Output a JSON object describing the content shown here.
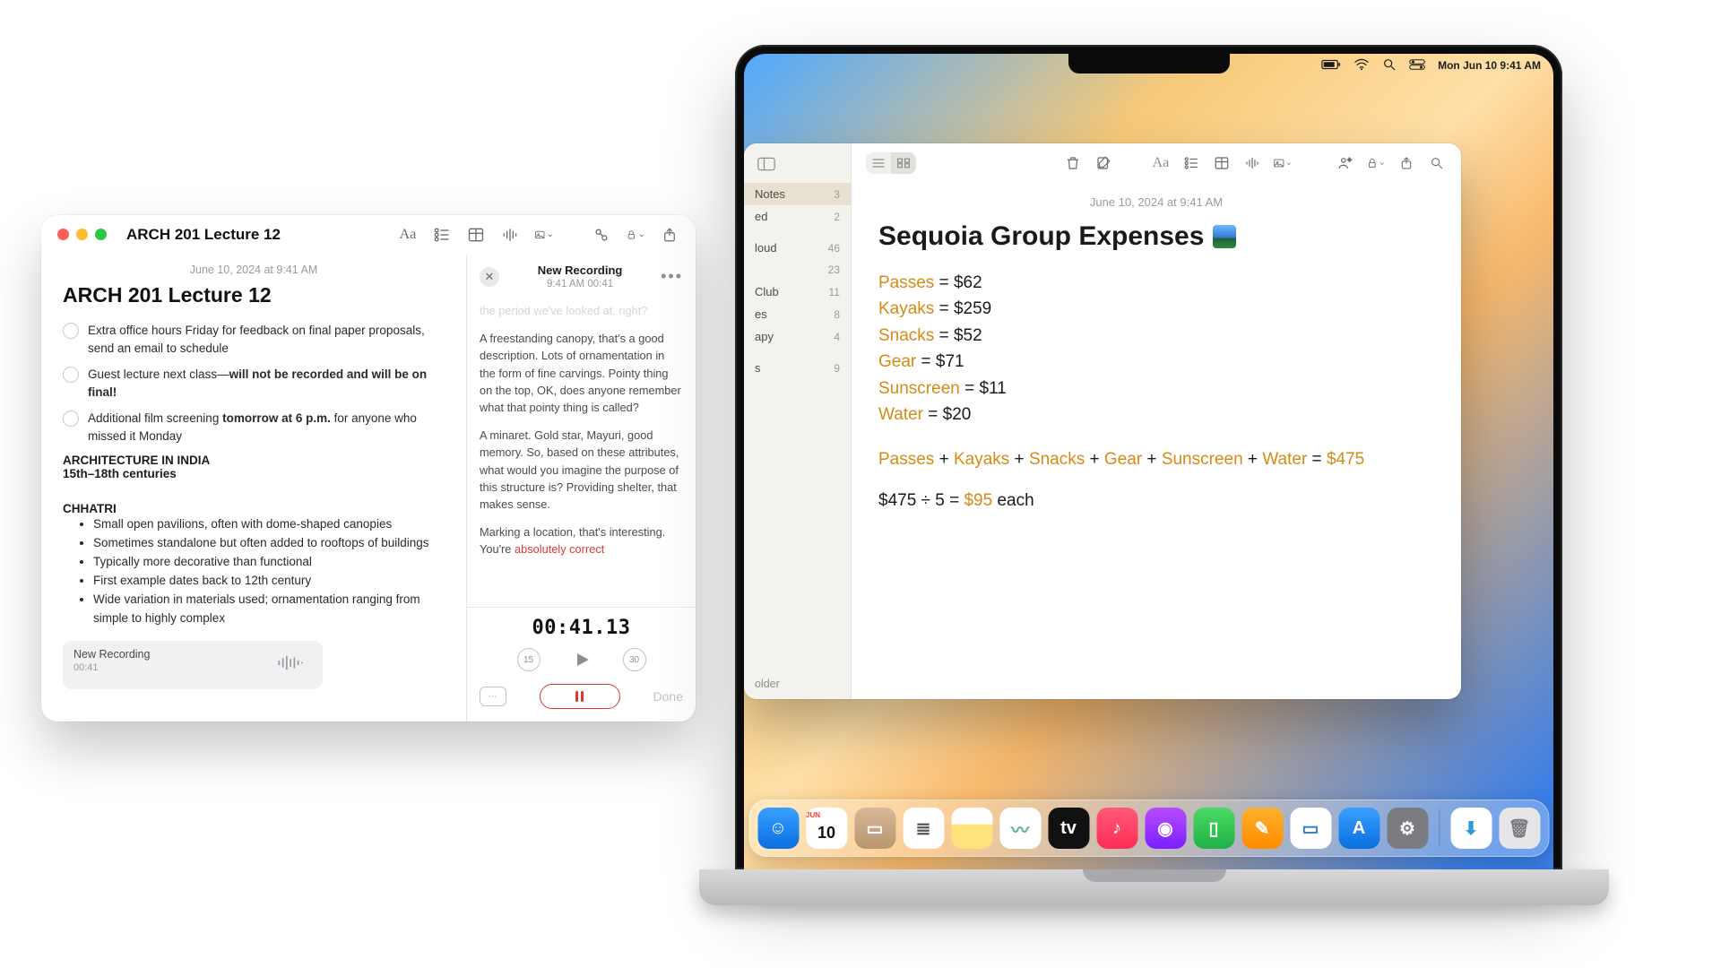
{
  "left_window": {
    "title": "ARCH 201 Lecture 12",
    "date": "June 10, 2024 at 9:41 AM",
    "heading": "ARCH 201 Lecture 12",
    "checks": [
      {
        "pre": "Extra office hours Friday for feedback on final paper proposals, send an email to schedule",
        "bold": "",
        "post": ""
      },
      {
        "pre": "Guest lecture next class—",
        "bold": "will not be recorded and will be on final!",
        "post": ""
      },
      {
        "pre": "Additional film screening ",
        "bold": "tomorrow at 6 p.m.",
        "post": " for anyone who missed it Monday"
      }
    ],
    "section_h": "ARCHITECTURE IN INDIA",
    "section_sub": "15th–18th centuries",
    "sub_h": "CHHATRI",
    "bullets": [
      "Small open pavilions, often with dome-shaped canopies",
      "Sometimes standalone but often added to rooftops of buildings",
      "Typically more decorative than functional",
      "First example dates back to 12th century",
      "Wide variation in materials used; ornamentation ranging from simple to highly complex"
    ],
    "rec_chip": {
      "title": "New Recording",
      "time": "00:41"
    },
    "side": {
      "title": "New Recording",
      "sub": "9:41 AM 00:41",
      "faded": "the period we've looked at, right?",
      "p1": "A freestanding canopy, that's a good description. Lots of ornamentation in the form of fine carvings. Pointy thing on the top, OK, does anyone remember what that pointy thing is called?",
      "p2": "A minaret. Gold star, Mayuri, good memory. So, based on these attributes, what would you imagine the purpose of this structure is? Providing shelter, that makes sense.",
      "p3_a": "Marking a location, that's interesting. You're ",
      "p3_b": "absolutely correct",
      "timer": "00:41.13",
      "skip_back": "15",
      "skip_fwd": "30",
      "done": "Done"
    }
  },
  "menubar": {
    "date": "Mon Jun 10  9:41 AM"
  },
  "notes_app": {
    "sidebar_items": [
      {
        "label": "Notes",
        "count": "3",
        "sel": true
      },
      {
        "label": "ed",
        "count": "2"
      },
      {
        "label": "",
        "count": ""
      },
      {
        "label": "loud",
        "count": "46"
      },
      {
        "label": "",
        "count": "23"
      },
      {
        "label": "Club",
        "count": "11"
      },
      {
        "label": "es",
        "count": "8"
      },
      {
        "label": "apy",
        "count": "4"
      },
      {
        "label": "",
        "count": ""
      },
      {
        "label": "s",
        "count": "9"
      }
    ],
    "sidebar_footer": "older",
    "date": "June 10, 2024 at 9:41 AM",
    "title": "Sequoia Group Expenses",
    "lines": [
      {
        "label": "Passes",
        "value": "$62"
      },
      {
        "label": "Kayaks",
        "value": "$259"
      },
      {
        "label": "Snacks",
        "value": "$52"
      },
      {
        "label": "Gear",
        "value": "$71"
      },
      {
        "label": "Sunscreen",
        "value": "$11"
      },
      {
        "label": "Water",
        "value": "$20"
      }
    ],
    "formula": {
      "items": [
        "Passes",
        "Kayaks",
        "Snacks",
        "Gear",
        "Sunscreen",
        "Water"
      ],
      "sum": "$475"
    },
    "result": {
      "lhs": "$475 ÷ 5 = ",
      "val": "$95",
      "tail": " each"
    }
  },
  "dock": [
    {
      "name": "finder",
      "bg": "linear-gradient(#3aa0ff,#0a6fe0)",
      "glyph": "☺"
    },
    {
      "name": "calendar",
      "bg": "#fff",
      "glyph": "10",
      "color": "#111"
    },
    {
      "name": "contacts",
      "bg": "linear-gradient(#d7b899,#b8966e)",
      "glyph": "▭"
    },
    {
      "name": "reminders",
      "bg": "#fff",
      "glyph": "≣",
      "color": "#555"
    },
    {
      "name": "notes",
      "bg": "linear-gradient(#fff 40%,#ffe37a 41%)",
      "glyph": ""
    },
    {
      "name": "freeform",
      "bg": "#fff",
      "glyph": "〰",
      "color": "#5a9"
    },
    {
      "name": "tv",
      "bg": "#111",
      "glyph": "tv"
    },
    {
      "name": "music",
      "bg": "linear-gradient(#ff5a78,#ff2d55)",
      "glyph": "♪"
    },
    {
      "name": "podcasts",
      "bg": "linear-gradient(#b84dff,#7a1fff)",
      "glyph": "◉"
    },
    {
      "name": "numbers",
      "bg": "linear-gradient(#4cd964,#20b246)",
      "glyph": "▯"
    },
    {
      "name": "pages",
      "bg": "linear-gradient(#ffb02e,#ff8c00)",
      "glyph": "✎"
    },
    {
      "name": "keynote",
      "bg": "#fff",
      "glyph": "▭",
      "color": "#2e7bd1"
    },
    {
      "name": "appstore",
      "bg": "linear-gradient(#3aa0ff,#0a6fe0)",
      "glyph": "A"
    },
    {
      "name": "settings",
      "bg": "#7b7b80",
      "glyph": "⚙"
    }
  ],
  "dock_right": [
    {
      "name": "downloads",
      "bg": "#fff",
      "glyph": "⬇",
      "color": "#2e9bd6"
    },
    {
      "name": "trash",
      "bg": "#e6e6e8",
      "glyph": "🗑",
      "color": "#7b7b80"
    }
  ]
}
